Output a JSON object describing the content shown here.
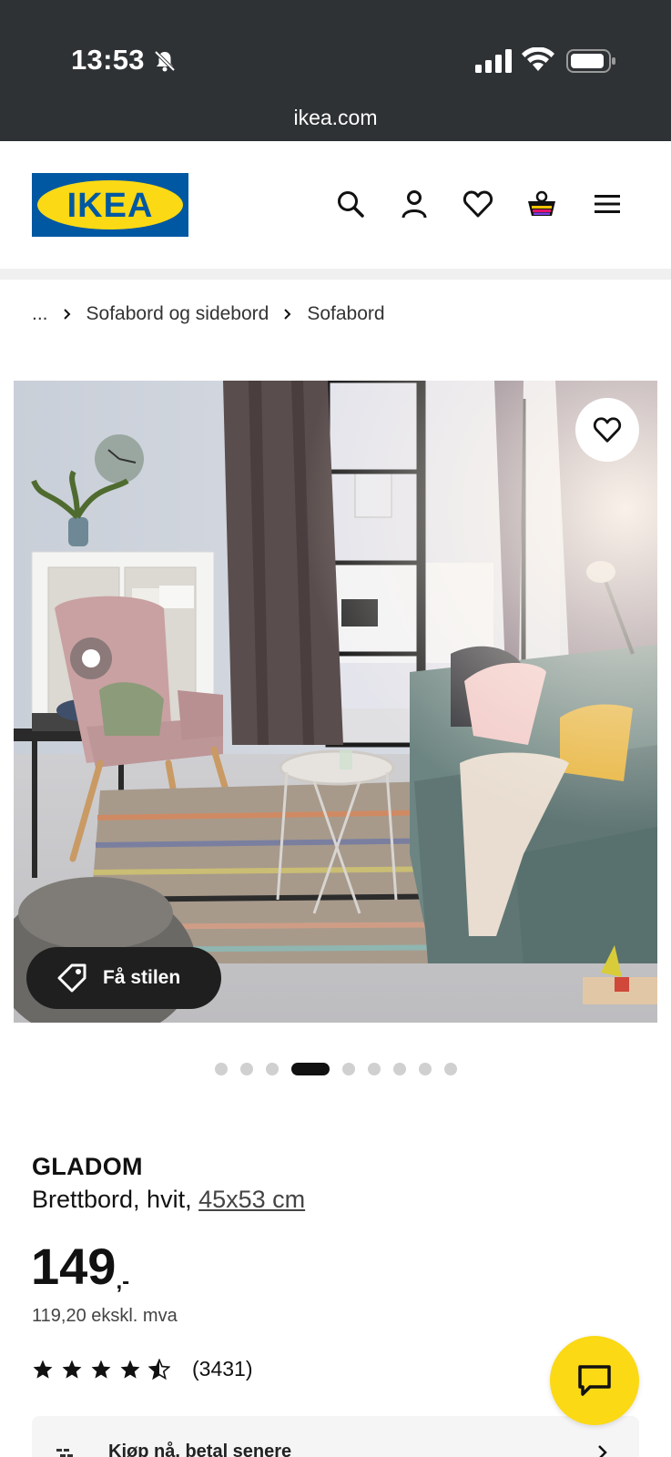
{
  "status_bar": {
    "time": "13:53",
    "url": "ikea.com"
  },
  "header": {
    "logo_text": "IKEA",
    "icons": [
      "search-icon",
      "profile-icon",
      "heart-icon",
      "cart-icon",
      "menu-icon"
    ]
  },
  "breadcrumb": {
    "ellipsis": "...",
    "items": [
      "Sofabord og sidebord",
      "Sofabord"
    ]
  },
  "hero": {
    "style_button_label": "Få stilen",
    "carousel_count": 9,
    "carousel_active_index": 3
  },
  "product": {
    "name": "GLADOM",
    "description": "Brettbord, hvit, ",
    "size_link": "45x53 cm",
    "price_main": "149",
    "price_suffix": ",-",
    "price_ex_vat": "119,20 ekskl. mva",
    "rating_stars": 4.5,
    "rating_count": "(3431)"
  },
  "pay_panel": {
    "label": "Kjøp nå, betal senere"
  },
  "colors": {
    "status_bg": "#2f3235",
    "ikea_blue": "#0058a3",
    "ikea_yellow": "#fbd914"
  }
}
